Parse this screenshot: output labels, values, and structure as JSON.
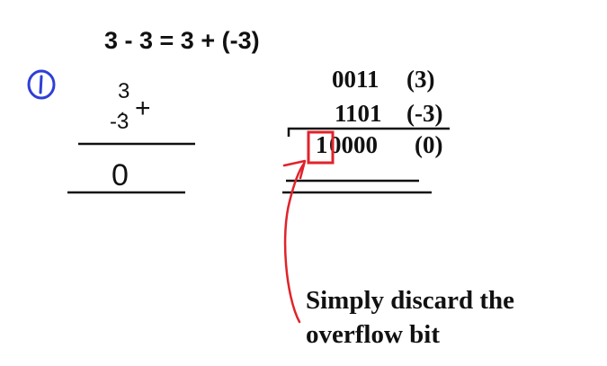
{
  "equation": "3 - 3 = 3 + (-3)",
  "step_marker": "1",
  "decimal": {
    "top": "3",
    "bottom": "-3",
    "operator": "+",
    "result": "0"
  },
  "binary": {
    "row1": {
      "bits": "0011",
      "value": "(3)"
    },
    "row2": {
      "bits": "1101",
      "value": "(-3)"
    },
    "row3": {
      "overflow_bit": "1",
      "bits": "0000",
      "value": "(0)"
    }
  },
  "annotation": {
    "line1": "Simply discard the",
    "line2": "overflow bit"
  },
  "colors": {
    "ink": "#111111",
    "marker": "#2f3fd6",
    "highlight": "#e0232b"
  }
}
